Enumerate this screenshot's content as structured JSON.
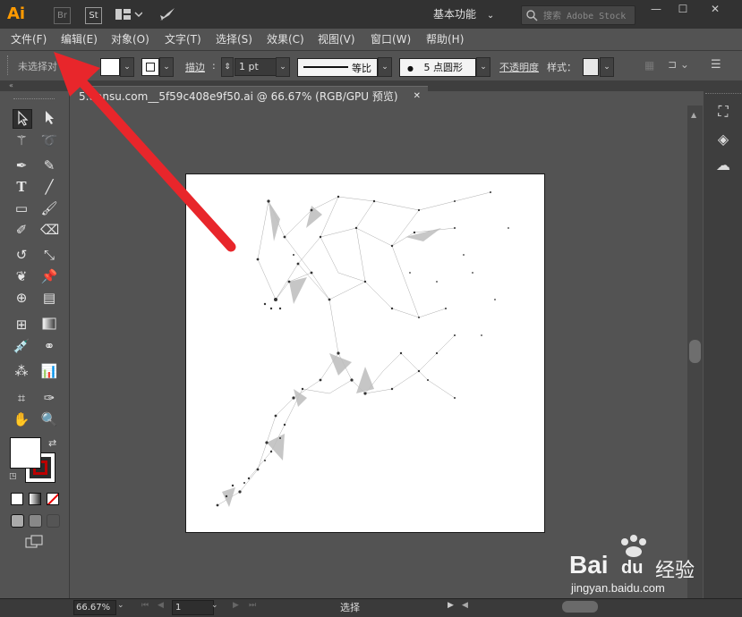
{
  "app": {
    "logo": "Ai",
    "bridge_label": "Br",
    "stock_label": "St"
  },
  "workspace": {
    "label": "基本功能"
  },
  "search": {
    "placeholder": "搜索 Adobe Stock"
  },
  "window_buttons": {
    "minimize": "—",
    "restore": "☐",
    "close": "✕"
  },
  "menu": [
    {
      "label": "文件(F)"
    },
    {
      "label": "编辑(E)"
    },
    {
      "label": "对象(O)"
    },
    {
      "label": "文字(T)"
    },
    {
      "label": "选择(S)"
    },
    {
      "label": "效果(C)"
    },
    {
      "label": "视图(V)"
    },
    {
      "label": "窗口(W)"
    },
    {
      "label": "帮助(H)"
    }
  ],
  "control": {
    "selection_status": "未选择对",
    "stroke_label": "描边",
    "stroke_weight": "1 pt",
    "profile_label": "等比",
    "brush_label": "5 点圆形",
    "brush_dot": "●",
    "opacity_label": "不透明度",
    "style_label": "样式："
  },
  "document_tab": {
    "title": "5.uansu.com__5f59c408e9f50.ai @ 66.67% (RGB/GPU 预览)",
    "close": "✕"
  },
  "status": {
    "zoom": "66.67%",
    "page": "1",
    "mode": "选择"
  },
  "watermark": {
    "brand": "Bai",
    "brand2": "du",
    "cn": "经验",
    "url": "jingyan.baidu.com"
  },
  "colors": {
    "arrow": "#e8262b",
    "logo": "#ff9a00",
    "bg": "#535353"
  }
}
